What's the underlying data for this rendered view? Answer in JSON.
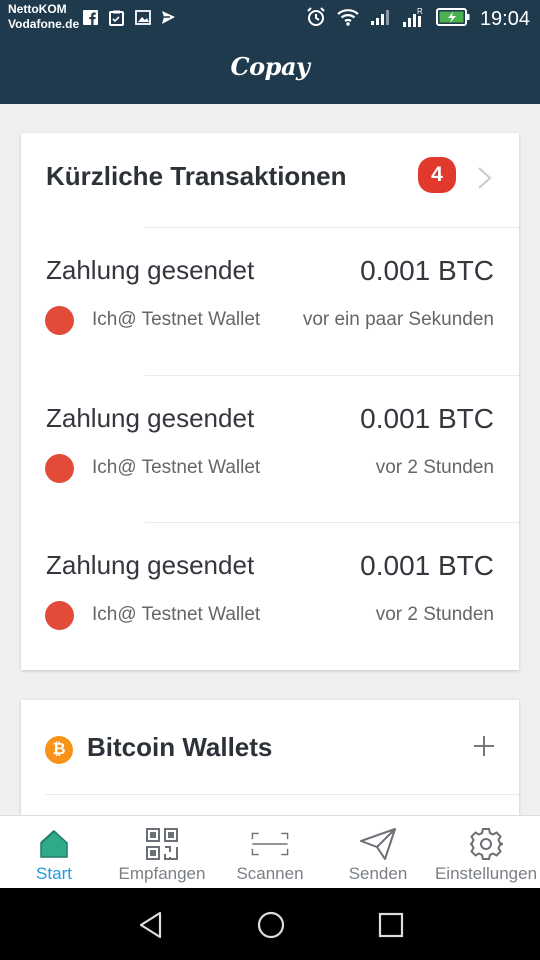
{
  "status_bar": {
    "carrier_line1": "NettoKOM",
    "carrier_line2": "Vodafone.de",
    "time": "19:04",
    "left_icons": [
      "facebook-icon",
      "clipboard-icon",
      "image-icon",
      "send-icon"
    ],
    "right_icons": [
      "alarm-icon",
      "wifi-icon",
      "signal-icon",
      "signal-r-icon",
      "battery-charging-icon"
    ]
  },
  "header": {
    "app_name": "Copay"
  },
  "recent_transactions": {
    "title": "Kürzliche Transaktionen",
    "badge_count": "4",
    "items": [
      {
        "label": "Zahlung gesendet",
        "amount": "0.001 BTC",
        "wallet": "Ich@ Testnet Wallet",
        "time": "vor ein paar Sekunden"
      },
      {
        "label": "Zahlung gesendet",
        "amount": "0.001 BTC",
        "wallet": "Ich@ Testnet Wallet",
        "time": "vor 2 Stunden"
      },
      {
        "label": "Zahlung gesendet",
        "amount": "0.001 BTC",
        "wallet": "Ich@ Testnet Wallet",
        "time": "vor 2 Stunden"
      }
    ]
  },
  "wallets": {
    "title": "Bitcoin Wallets",
    "btc_symbol": "₿"
  },
  "tabs": [
    {
      "label": "Start",
      "icon": "home-icon",
      "active": true
    },
    {
      "label": "Empfangen",
      "icon": "qr-code-icon",
      "active": false
    },
    {
      "label": "Scannen",
      "icon": "scan-icon",
      "active": false
    },
    {
      "label": "Senden",
      "icon": "paper-plane-icon",
      "active": false
    },
    {
      "label": "Einstellungen",
      "icon": "gear-icon",
      "active": false
    }
  ],
  "colors": {
    "header_bg": "#1f3a4c",
    "badge": "#e13a2d",
    "tx_dot": "#e14b37",
    "btc_orange": "#f7931a",
    "active_tab": "#1e9ce8",
    "home_icon_fill": "#2ea98a"
  }
}
